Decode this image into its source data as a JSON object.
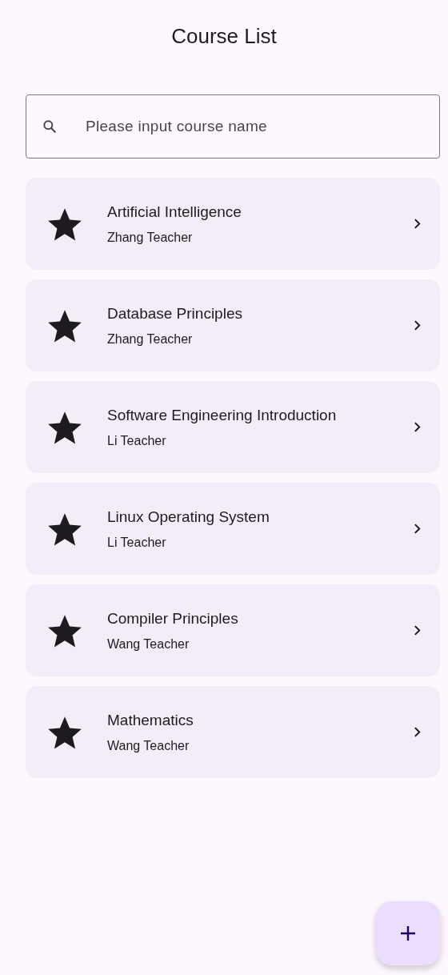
{
  "title": "Course List",
  "search": {
    "placeholder": "Please input course name"
  },
  "courses": [
    {
      "name": "Artificial Intelligence",
      "teacher": "Zhang Teacher"
    },
    {
      "name": "Database Principles",
      "teacher": "Zhang Teacher"
    },
    {
      "name": "Software Engineering Introduction",
      "teacher": "Li Teacher"
    },
    {
      "name": "Linux Operating System",
      "teacher": "Li Teacher"
    },
    {
      "name": "Compiler Principles",
      "teacher": "Wang Teacher"
    },
    {
      "name": "Mathematics",
      "teacher": "Wang Teacher"
    }
  ]
}
